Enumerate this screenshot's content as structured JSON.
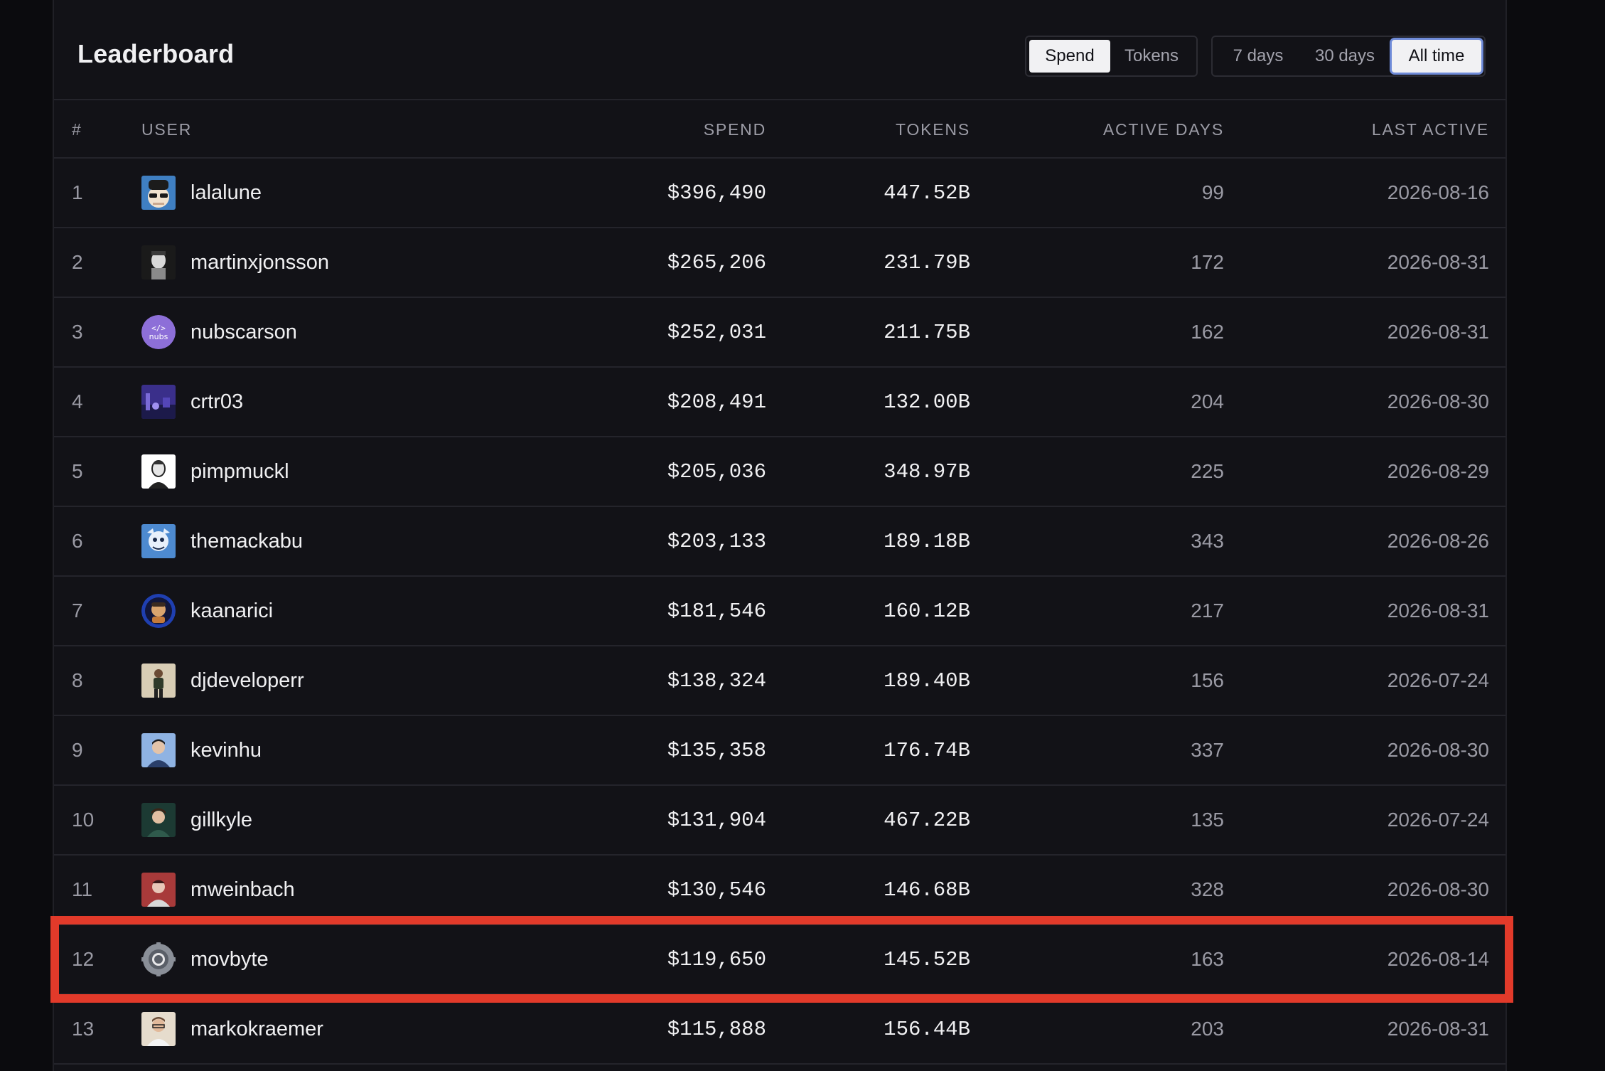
{
  "header": {
    "title": "Leaderboard",
    "metric_tabs": [
      {
        "label": "Spend",
        "active": true
      },
      {
        "label": "Tokens",
        "active": false
      }
    ],
    "range_tabs": [
      {
        "label": "7 days",
        "active": false
      },
      {
        "label": "30 days",
        "active": false
      },
      {
        "label": "All time",
        "active": true
      }
    ]
  },
  "columns": {
    "rank": "#",
    "user": "USER",
    "spend": "SPEND",
    "tokens": "TOKENS",
    "active_days": "ACTIVE DAYS",
    "last_active": "LAST ACTIVE"
  },
  "rows": [
    {
      "rank": "1",
      "user": "lalalune",
      "spend": "$396,490",
      "tokens": "447.52B",
      "active_days": "99",
      "last_active": "2026-08-16",
      "avatar": "cartoon-sunglasses-icon"
    },
    {
      "rank": "2",
      "user": "martinxjonsson",
      "spend": "$265,206",
      "tokens": "231.79B",
      "active_days": "172",
      "last_active": "2026-08-31",
      "avatar": "portrait-bw-icon"
    },
    {
      "rank": "3",
      "user": "nubscarson",
      "spend": "$252,031",
      "tokens": "211.75B",
      "active_days": "162",
      "last_active": "2026-08-31",
      "avatar": "nubs-code-logo-icon"
    },
    {
      "rank": "4",
      "user": "crtr03",
      "spend": "$208,491",
      "tokens": "132.00B",
      "active_days": "204",
      "last_active": "2026-08-30",
      "avatar": "purple-night-icon"
    },
    {
      "rank": "5",
      "user": "pimpmuckl",
      "spend": "$205,036",
      "tokens": "348.97B",
      "active_days": "225",
      "last_active": "2026-08-29",
      "avatar": "portrait-sketch-icon"
    },
    {
      "rank": "6",
      "user": "themackabu",
      "spend": "$203,133",
      "tokens": "189.18B",
      "active_days": "343",
      "last_active": "2026-08-26",
      "avatar": "blue-character-icon"
    },
    {
      "rank": "7",
      "user": "kaanarici",
      "spend": "$181,546",
      "tokens": "160.12B",
      "active_days": "217",
      "last_active": "2026-08-31",
      "avatar": "round-cartoon-icon"
    },
    {
      "rank": "8",
      "user": "djdeveloperr",
      "spend": "$138,324",
      "tokens": "189.40B",
      "active_days": "156",
      "last_active": "2026-07-24",
      "avatar": "standing-person-icon"
    },
    {
      "rank": "9",
      "user": "kevinhu",
      "spend": "$135,358",
      "tokens": "176.74B",
      "active_days": "337",
      "last_active": "2026-08-30",
      "avatar": "portrait-blue-icon"
    },
    {
      "rank": "10",
      "user": "gillkyle",
      "spend": "$131,904",
      "tokens": "467.22B",
      "active_days": "135",
      "last_active": "2026-07-24",
      "avatar": "portrait-green-icon"
    },
    {
      "rank": "11",
      "user": "mweinbach",
      "spend": "$130,546",
      "tokens": "146.68B",
      "active_days": "328",
      "last_active": "2026-08-30",
      "avatar": "portrait-red-icon"
    },
    {
      "rank": "12",
      "user": "movbyte",
      "spend": "$119,650",
      "tokens": "145.52B",
      "active_days": "163",
      "last_active": "2026-08-14",
      "avatar": "gear-logo-icon"
    },
    {
      "rank": "13",
      "user": "markokraemer",
      "spend": "$115,888",
      "tokens": "156.44B",
      "active_days": "203",
      "last_active": "2026-08-31",
      "avatar": "portrait-light-icon"
    }
  ],
  "highlighted_rank": "12",
  "colors": {
    "highlight": "#e23a2a",
    "panel": "#121217",
    "background": "#0b0b0e",
    "active_outline": "#6f8bd8"
  }
}
